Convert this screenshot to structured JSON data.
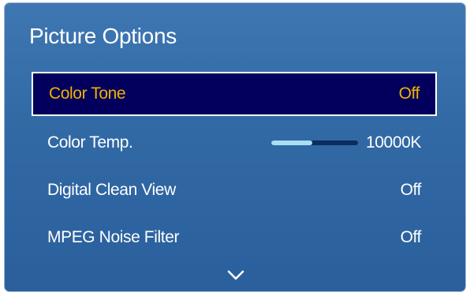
{
  "menu": {
    "title": "Picture Options",
    "items": [
      {
        "label": "Color Tone",
        "value": "Off",
        "selected": true
      },
      {
        "label": "Color Temp.",
        "value": "10000K",
        "slider_fraction": 0.47
      },
      {
        "label": "Digital Clean View",
        "value": "Off"
      },
      {
        "label": "MPEG Noise Filter",
        "value": "Off"
      }
    ],
    "more_indicator_icon": "chevron-down-icon"
  },
  "colors": {
    "panel": "#326aa6",
    "selected_bg": "#02005c",
    "selected_text": "#f2b200",
    "text": "#ffffff",
    "slider_fill": "#a9dff0",
    "slider_track": "#0b2e5e"
  }
}
